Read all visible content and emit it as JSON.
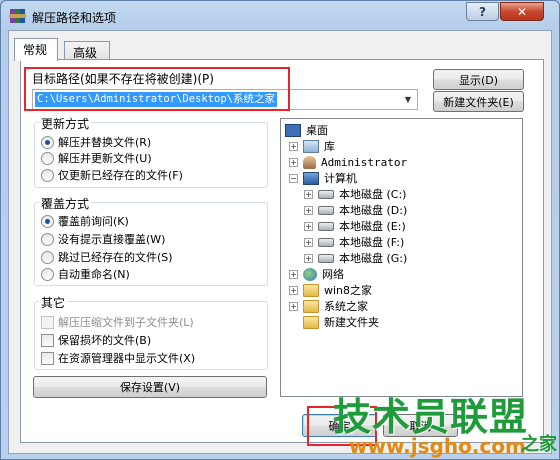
{
  "window": {
    "title": "解压路径和选项",
    "help_label": "?",
    "close_label": "✕"
  },
  "tabs": [
    {
      "label": "常规",
      "active": true
    },
    {
      "label": "高级",
      "active": false
    }
  ],
  "destination": {
    "label": "目标路径(如果不存在将被创建)(P)",
    "value": "C:\\Users\\Administrator\\Desktop\\系统之家"
  },
  "buttons": {
    "show": "显示(D)",
    "new_folder": "新建文件夹(E)",
    "save_settings": "保存设置(V)",
    "ok": "确定",
    "cancel": "取消"
  },
  "update_mode": {
    "title": "更新方式",
    "options": [
      {
        "label": "解压并替换文件(R)",
        "selected": true
      },
      {
        "label": "解压并更新文件(U)",
        "selected": false
      },
      {
        "label": "仅更新已经存在的文件(F)",
        "selected": false
      }
    ]
  },
  "overwrite_mode": {
    "title": "覆盖方式",
    "options": [
      {
        "label": "覆盖前询问(K)",
        "selected": true
      },
      {
        "label": "没有提示直接覆盖(W)",
        "selected": false
      },
      {
        "label": "跳过已经存在的文件(S)",
        "selected": false
      },
      {
        "label": "自动重命名(N)",
        "selected": false
      }
    ]
  },
  "misc": {
    "title": "其它",
    "options": [
      {
        "label": "解压压缩文件到子文件夹(L)",
        "checked": false,
        "disabled": true
      },
      {
        "label": "保留损坏的文件(B)",
        "checked": false,
        "disabled": false
      },
      {
        "label": "在资源管理器中显示文件(X)",
        "checked": false,
        "disabled": false
      }
    ]
  },
  "tree": {
    "desktop": "桌面",
    "library": "库",
    "user": "Administrator",
    "computer": "计算机",
    "disks": [
      "本地磁盘 (C:)",
      "本地磁盘 (D:)",
      "本地磁盘 (E:)",
      "本地磁盘 (F:)",
      "本地磁盘 (G:)"
    ],
    "network": "网络",
    "folders": [
      "win8之家",
      "系统之家",
      "新建文件夹"
    ]
  },
  "watermark": {
    "main": "技术员联盟",
    "url": "www.jsgho.com",
    "suffix": "之家"
  },
  "colors": {
    "selection": "#3399ff",
    "highlight_box": "#e8252c",
    "watermark_green": "#1f9b3a",
    "watermark_orange": "#e28a12"
  }
}
